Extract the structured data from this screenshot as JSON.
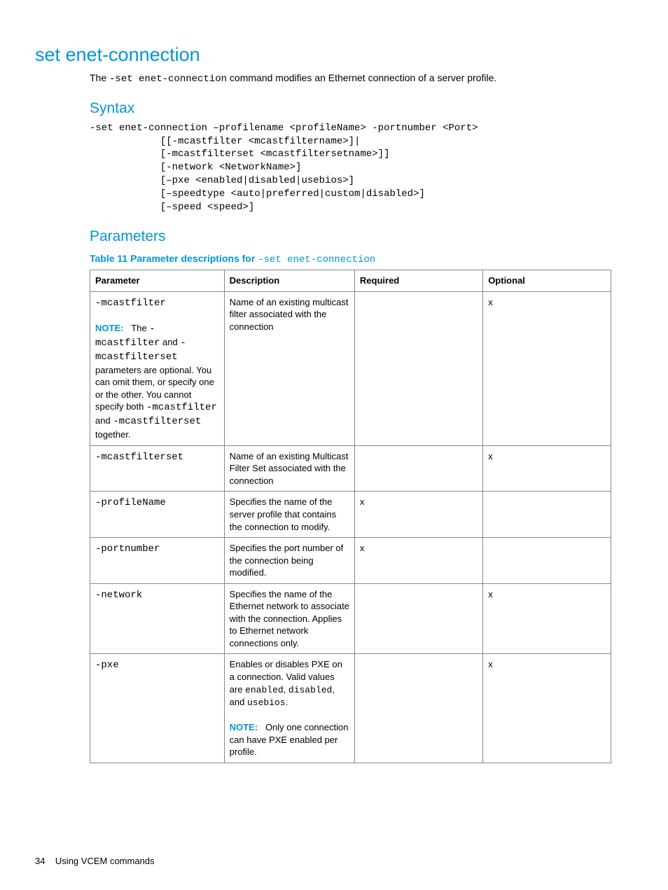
{
  "page": {
    "number": "34",
    "footer_text": "Using VCEM commands"
  },
  "section": {
    "title": "set enet-connection",
    "intro_pre": "The ",
    "intro_code": "-set enet-connection",
    "intro_post": " command modifies an Ethernet connection of a server profile."
  },
  "syntax": {
    "heading": "Syntax",
    "code": "-set enet-connection –profilename <profileName> -portnumber <Port>\n            [[-mcastfilter <mcastfiltername>]|\n            [-mcastfilterset <mcastfiltersetname>]]\n            [-network <NetworkName>]\n            [–pxe <enabled|disabled|usebios>]\n            [–speedtype <auto|preferred|custom|disabled>]\n            [–speed <speed>]"
  },
  "parameters": {
    "heading": "Parameters",
    "caption_pre": "Table 11 Parameter descriptions for ",
    "caption_code": "-set enet-connection",
    "headers": {
      "parameter": "Parameter",
      "description": "Description",
      "required": "Required",
      "optional": "Optional"
    },
    "rows": [
      {
        "param_html": "<span class=\"mono\">-mcastfilter</span><br><br><span class=\"note-label\">NOTE:</span>&nbsp;&nbsp;&nbsp;The <span class=\"mono\">-mcastfilter</span> and <span class=\"mono\">-mcastfilterset</span> parameters are optional. You can omit them, or specify one or the other. You cannot specify both <span class=\"mono\">-mcastfilter</span> and <span class=\"mono\">-mcastfilterset</span> together.",
        "desc_html": "Name of an existing multicast filter associated with the connection",
        "required": "",
        "optional": "x"
      },
      {
        "param_html": "<span class=\"mono\">-mcastfilterset</span>",
        "desc_html": "Name of an existing Multicast Filter Set associated with the connection",
        "required": "",
        "optional": "x"
      },
      {
        "param_html": "<span class=\"mono\">-profileName</span>",
        "desc_html": "Specifies the name of the server profile that contains the connection to modify.",
        "required": "x",
        "optional": ""
      },
      {
        "param_html": "<span class=\"mono\">-portnumber</span>",
        "desc_html": "Specifies the port number of the connection being modified.",
        "required": "x",
        "optional": ""
      },
      {
        "param_html": "<span class=\"mono\">-network</span>",
        "desc_html": "Specifies the name of the Ethernet network to associate with the connection. Applies to Ethernet network connections only.",
        "required": "",
        "optional": "x"
      },
      {
        "param_html": "<span class=\"mono\">-pxe</span>",
        "desc_html": "Enables or disables PXE on a connection. Valid values are <span class=\"mono\">enabled</span>, <span class=\"mono\">disabled</span>, and <span class=\"mono\">usebios</span>.<br><br><span class=\"note-label\">NOTE:</span>&nbsp;&nbsp;&nbsp;Only one connection can have PXE enabled per profile.",
        "required": "",
        "optional": "x"
      }
    ]
  }
}
